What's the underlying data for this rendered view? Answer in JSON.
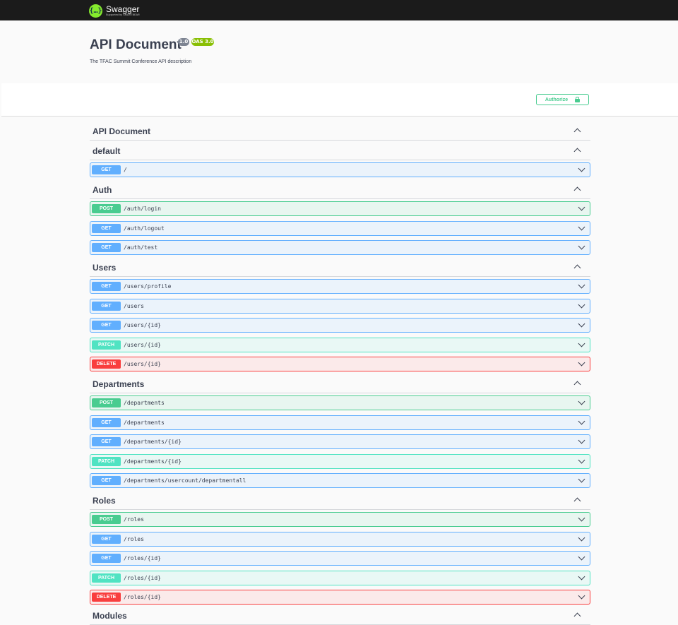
{
  "topbar": {
    "brand": "Swagger",
    "brand_sub": "Supported by SMARTBEAR"
  },
  "info": {
    "title": "API Document",
    "version_badge": "1.0",
    "oas_badge": "OAS 3.0",
    "description": "The TFAC Summit Conference API description"
  },
  "scheme": {
    "authorize_label": "Authorize"
  },
  "colors": {
    "get": "#61affe",
    "post": "#49cc90",
    "patch": "#50e3c2",
    "delete": "#f93e3e",
    "topbar": "#1b1b1b"
  },
  "sections": [
    {
      "name": "API Document",
      "ops": []
    },
    {
      "name": "default",
      "ops": [
        {
          "method": "GET",
          "path": "/"
        }
      ]
    },
    {
      "name": "Auth",
      "ops": [
        {
          "method": "POST",
          "path": "/auth/login"
        },
        {
          "method": "GET",
          "path": "/auth/logout"
        },
        {
          "method": "GET",
          "path": "/auth/test"
        }
      ]
    },
    {
      "name": "Users",
      "ops": [
        {
          "method": "GET",
          "path": "/users/profile"
        },
        {
          "method": "GET",
          "path": "/users"
        },
        {
          "method": "GET",
          "path": "/users/{id}"
        },
        {
          "method": "PATCH",
          "path": "/users/{id}"
        },
        {
          "method": "DELETE",
          "path": "/users/{id}"
        }
      ]
    },
    {
      "name": "Departments",
      "ops": [
        {
          "method": "POST",
          "path": "/departments"
        },
        {
          "method": "GET",
          "path": "/departments"
        },
        {
          "method": "GET",
          "path": "/departments/{id}"
        },
        {
          "method": "PATCH",
          "path": "/departments/{id}"
        },
        {
          "method": "GET",
          "path": "/departments/usercount/departmentall"
        }
      ]
    },
    {
      "name": "Roles",
      "ops": [
        {
          "method": "POST",
          "path": "/roles"
        },
        {
          "method": "GET",
          "path": "/roles"
        },
        {
          "method": "GET",
          "path": "/roles/{id}"
        },
        {
          "method": "PATCH",
          "path": "/roles/{id}"
        },
        {
          "method": "DELETE",
          "path": "/roles/{id}"
        }
      ]
    },
    {
      "name": "Modules",
      "ops": []
    }
  ]
}
